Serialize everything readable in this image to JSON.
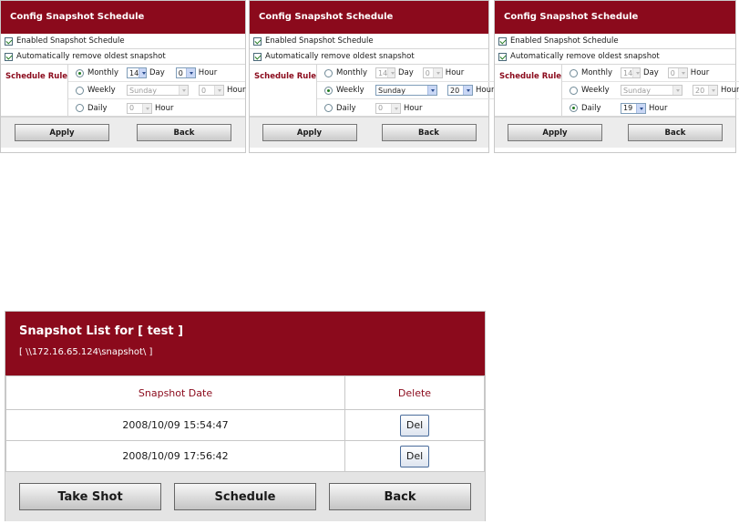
{
  "panels": [
    {
      "title": "Config Snapshot Schedule",
      "enabled_label": "Enabled Snapshot Schedule",
      "auto_remove_label": "Automatically remove oldest snapshot",
      "rule_label": "Schedule Rule",
      "monthly": {
        "label": "Monthly",
        "day_value": "14",
        "day_unit": "Day",
        "hour_value": "0",
        "hour_unit": "Hour"
      },
      "weekly": {
        "label": "Weekly",
        "day_value": "Sunday",
        "hour_value": "0",
        "hour_unit": "Hour"
      },
      "daily": {
        "label": "Daily",
        "hour_value": "0",
        "hour_unit": "Hour"
      },
      "apply_label": "Apply",
      "back_label": "Back"
    },
    {
      "title": "Config Snapshot Schedule",
      "enabled_label": "Enabled Snapshot Schedule",
      "auto_remove_label": "Automatically remove oldest snapshot",
      "rule_label": "Schedule Rule",
      "monthly": {
        "label": "Monthly",
        "day_value": "14",
        "day_unit": "Day",
        "hour_value": "0",
        "hour_unit": "Hour"
      },
      "weekly": {
        "label": "Weekly",
        "day_value": "Sunday",
        "hour_value": "20",
        "hour_unit": "Hour"
      },
      "daily": {
        "label": "Daily",
        "hour_value": "0",
        "hour_unit": "Hour"
      },
      "apply_label": "Apply",
      "back_label": "Back"
    },
    {
      "title": "Config Snapshot Schedule",
      "enabled_label": "Enabled Snapshot Schedule",
      "auto_remove_label": "Automatically remove oldest snapshot",
      "rule_label": "Schedule Rule",
      "monthly": {
        "label": "Monthly",
        "day_value": "14",
        "day_unit": "Day",
        "hour_value": "0",
        "hour_unit": "Hour"
      },
      "weekly": {
        "label": "Weekly",
        "day_value": "Sunday",
        "hour_value": "20",
        "hour_unit": "Hour"
      },
      "daily": {
        "label": "Daily",
        "hour_value": "19",
        "hour_unit": "Hour"
      },
      "apply_label": "Apply",
      "back_label": "Back"
    }
  ],
  "snapshot_list": {
    "title": "Snapshot List for [ test ]",
    "path": "[ \\\\172.16.65.124\\snapshot\\ ]",
    "col_date": "Snapshot Date",
    "col_delete": "Delete",
    "rows": [
      {
        "date": "2008/10/09 15:54:47",
        "del_label": "Del"
      },
      {
        "date": "2008/10/09 17:56:42",
        "del_label": "Del"
      }
    ],
    "take_shot_label": "Take Shot",
    "schedule_label": "Schedule",
    "back_label": "Back"
  },
  "colors": {
    "header": "#8b0a1c",
    "check": "#1f7a1f"
  }
}
